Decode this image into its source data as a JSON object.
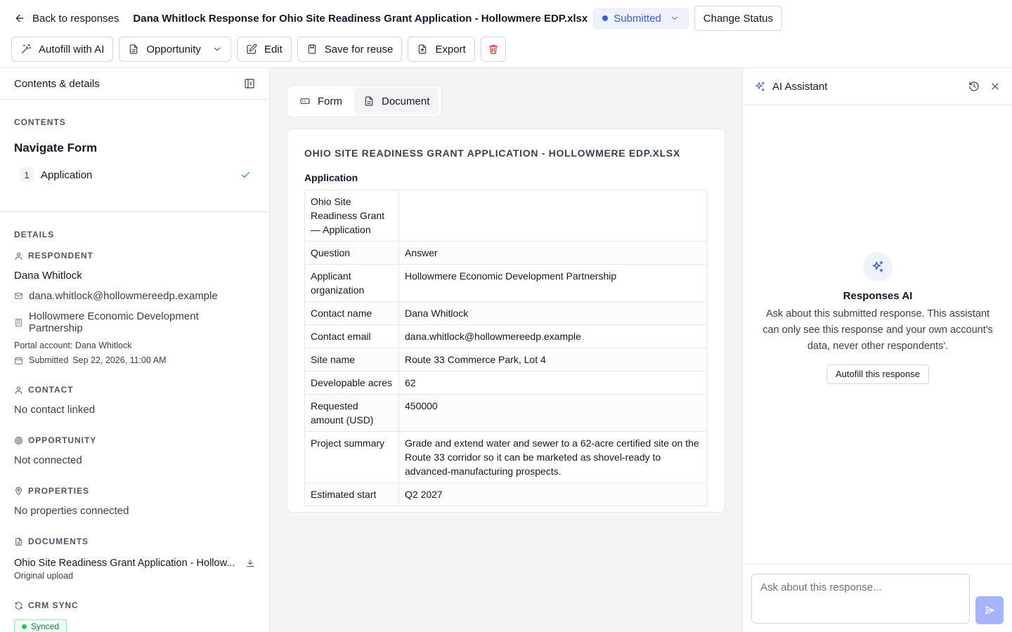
{
  "header": {
    "back_label": "Back to responses",
    "title": "Dana Whitlock Response for Ohio Site Readiness Grant Application - Hollowmere EDP.xlsx",
    "status": "Submitted",
    "change_status": "Change Status"
  },
  "toolbar": {
    "autofill": "Autofill with AI",
    "opportunity": "Opportunity",
    "edit": "Edit",
    "save_reuse": "Save for reuse",
    "export": "Export"
  },
  "sidebar": {
    "title": "Contents & details",
    "contents_label": "CONTENTS",
    "nav_title": "Navigate Form",
    "nav_items": [
      {
        "number": "1",
        "label": "Application"
      }
    ],
    "details_label": "DETAILS",
    "respondent_label": "RESPONDENT",
    "respondent_name": "Dana Whitlock",
    "respondent_email": "dana.whitlock@hollowmereedp.example",
    "respondent_org": "Hollowmere Economic Development Partnership",
    "portal_account": "Portal account: Dana Whitlock",
    "submitted_label": "Submitted",
    "submitted_at": "Sep 22, 2026, 11:00 AM",
    "contact_label": "CONTACT",
    "contact_value": "No contact linked",
    "opportunity_label": "OPPORTUNITY",
    "opportunity_value": "Not connected",
    "properties_label": "PROPERTIES",
    "properties_value": "No properties connected",
    "documents_label": "DOCUMENTS",
    "document_name": "Ohio Site Readiness Grant Application - Hollow...",
    "document_sub": "Original upload",
    "crm_label": "CRM SYNC",
    "crm_status": "Synced"
  },
  "main": {
    "tabs": [
      {
        "label": "Form"
      },
      {
        "label": "Document"
      }
    ],
    "active_tab": "Document",
    "doc_title": "OHIO SITE READINESS GRANT APPLICATION - HOLLOWMERE EDP.XLSX",
    "section": "Application",
    "rows": [
      {
        "q": "Ohio Site Readiness Grant — Application",
        "a": ""
      },
      {
        "q": "Question",
        "a": "Answer"
      },
      {
        "q": "Applicant organization",
        "a": "Hollowmere Economic Development Partnership"
      },
      {
        "q": "Contact name",
        "a": "Dana Whitlock"
      },
      {
        "q": "Contact email",
        "a": "dana.whitlock@hollowmereedp.example"
      },
      {
        "q": "Site name",
        "a": "Route 33 Commerce Park, Lot 4"
      },
      {
        "q": "Developable acres",
        "a": "62"
      },
      {
        "q": "Requested amount (USD)",
        "a": "450000"
      },
      {
        "q": "Project summary",
        "a": "Grade and extend water and sewer to a 62-acre certified site on the Route 33 corridor so it can be marketed as shovel-ready to advanced-manufacturing prospects."
      },
      {
        "q": "Estimated start",
        "a": "Q2 2027"
      }
    ]
  },
  "assistant": {
    "title": "AI Assistant",
    "empty_title": "Responses AI",
    "empty_desc": "Ask about this submitted response. This assistant can only see this response and your own account's data, never other respondents'.",
    "autofill": "Autofill this response",
    "input_placeholder": "Ask about this response..."
  }
}
